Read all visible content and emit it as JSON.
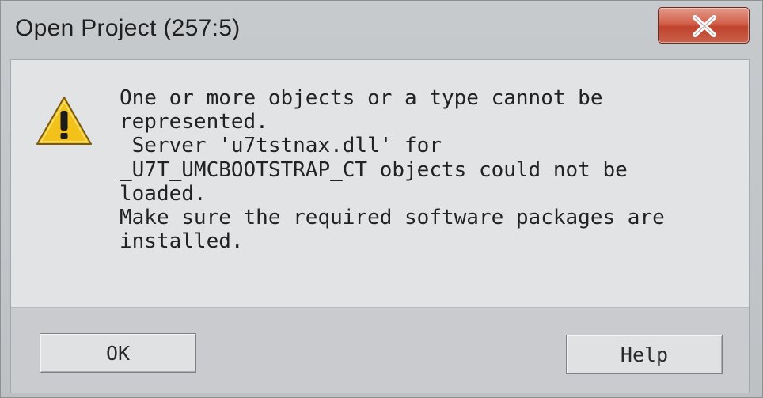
{
  "dialog": {
    "title": "Open Project (257:5)",
    "close_icon": "close-x-icon",
    "warning_icon": "warning-triangle-icon",
    "message_lines": [
      "One or more objects or a type cannot be",
      "represented.",
      " Server 'u7tstnax.dll' for",
      "_U7T_UMCBOOTSTRAP_CT objects could not be",
      "loaded.",
      "Make sure the required software packages are",
      "installed."
    ],
    "buttons": {
      "ok_label": "OK",
      "help_label": "Help"
    }
  },
  "colors": {
    "close_button": "#c9503a",
    "warning_yellow": "#f2c21a"
  }
}
